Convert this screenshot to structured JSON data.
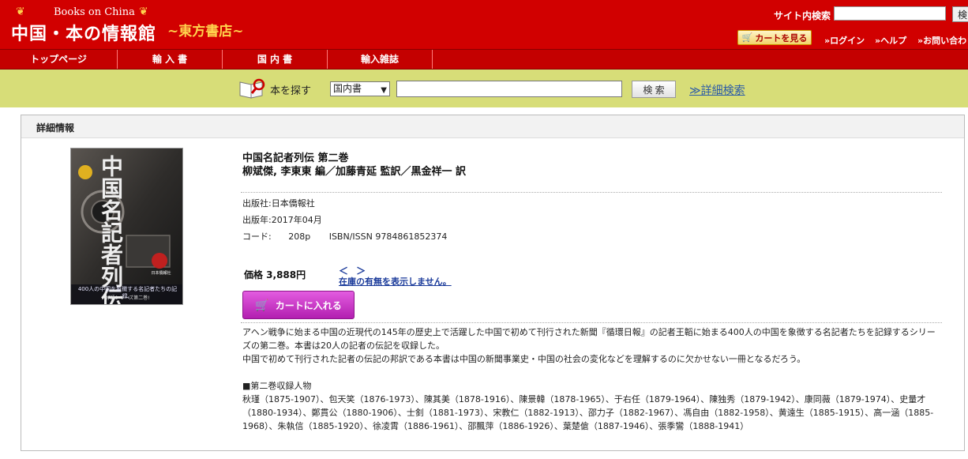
{
  "header": {
    "logo_en": "Books on China",
    "logo_main": "中国・本の情報館",
    "logo_sub": "~東方書店~",
    "site_search_label": "サイト内検索",
    "site_search_button": "検",
    "cart_view_button": "カートを見る",
    "links": [
      "»ログイン",
      "»ヘルプ",
      "»お問い合わ"
    ]
  },
  "nav": {
    "items": [
      "トップページ",
      "輸 入 書",
      "国 内 書",
      "輸入雑誌"
    ]
  },
  "search": {
    "label": "本を探す",
    "category": "国内書",
    "keyword": "",
    "button": "検 索",
    "advanced_link": "≫詳細検索"
  },
  "detail": {
    "heading": "詳細情報",
    "cover_title": "中国名記者列伝",
    "cover_caption": "400人の中国を象徴する名記者たちの記録。",
    "cover_series": "好評シリーズ第二巻!",
    "cover_publisher": "日本僑報社",
    "title": "中国名記者列伝 第二巻",
    "authors": "柳斌傑, 李東東 編／加藤青延 監訳／黒金祥一 訳",
    "publisher": "出版社:日本僑報社",
    "pub_date": "出版年:2017年04月",
    "code_label": "コード:",
    "pages": "208p",
    "isbn": "ISBN/ISSN 9784861852374",
    "price": "価格 3,888円",
    "stock_arrows": "＜ ＞",
    "stock_message": "在庫の有無を表示しません。",
    "cart_button": "カートに入れる",
    "description": [
      "アヘン戦争に始まる中国の近現代の145年の歴史上で活躍した中国で初めて刊行された新聞『循環日報』の記者王韜に始まる400人の中国を象徴する名記者たちを記録するシリーズの第二巻。本書は20人の記者の伝記を収録した。",
      "中国で初めて刊行された記者の伝記の邦訳である本書は中国の新聞事業史・中国の社会の変化などを理解するのに欠かせない一冊となるだろう。"
    ],
    "contents_heading": "■第二巻収録人物",
    "contents": "秋瑾（1875-1907）、包天笑（1876-1973）、陳其美（1878-1916）、陳景韓（1878-1965）、于右任（1879-1964）、陳独秀（1879-1942）、康同薇（1879-1974）、史量才（1880-1934）、鄭貫公（1880-1906）、士釗（1881-1973）、宋教仁（1882-1913）、邵力子（1882-1967）、馮自由（1882-1958）、黄遠生（1885-1915）、高一涵（1885-1968）、朱執信（1885-1920）、徐凌霄（1886-1961）、邵飄萍（1886-1926）、葉楚傖（1887-1946）、張季鸞（1888-1941）"
  },
  "colors": {
    "header_red": "#d10000",
    "search_band": "#d7dd78",
    "cart_magenta": "#c534c2",
    "link_blue": "#2a5aa8"
  }
}
